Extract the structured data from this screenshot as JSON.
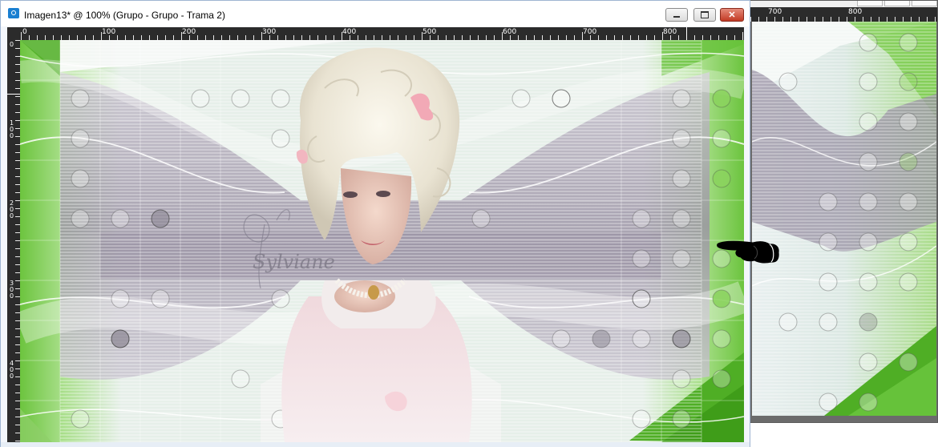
{
  "window": {
    "title": "Imagen13* @ 100% (Grupo - Grupo - Trama 2)",
    "buttons": {
      "minimize": "minimize",
      "maximize": "maximize",
      "close": "✕"
    }
  },
  "ruler": {
    "h_labels": [
      "0",
      "100",
      "200",
      "300",
      "400",
      "500",
      "600",
      "700",
      "800"
    ],
    "v_labels": [
      "0",
      "1\n0\n0",
      "2\n0\n0",
      "3\n0\n0",
      "4\n0\n0"
    ]
  },
  "second_window": {
    "ruler_labels": [
      "700",
      "800"
    ]
  },
  "canvas": {
    "watermark": "Sylviane",
    "accent_green": "#5fbf2f",
    "light_green": "#d9f0c8",
    "mauve": "#9a91a4"
  },
  "cursor": {
    "icon": "pointing-hand-icon"
  }
}
